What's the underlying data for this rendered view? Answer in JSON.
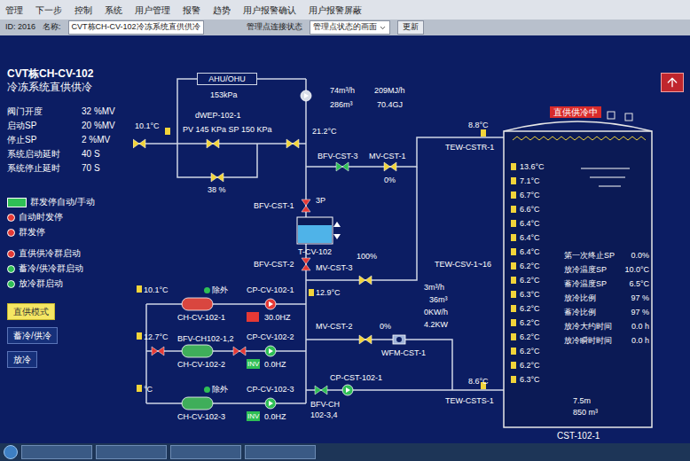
{
  "menu": [
    "管理",
    "下一步",
    "控制",
    "系统",
    "用户管理",
    "报警",
    "趋势",
    "用户报警确认",
    "用户报警屏蔽"
  ],
  "toolbar": {
    "id": "ID: 2016",
    "name_label": "名称:",
    "name": "CVT栋CH-CV-102冷冻系统直供供冷",
    "view_label": "管理点连接状态",
    "view": "管理点状态的画面",
    "button": "更新"
  },
  "panel": {
    "title": "CVT栋CH-CV-102",
    "subtitle": "冷冻系统直供供冷",
    "params": [
      {
        "label": "阀门开度",
        "value": "32 %MV"
      },
      {
        "label": "启动SP",
        "value": "20 %MV"
      },
      {
        "label": "停止SP",
        "value": "2 %MV"
      },
      {
        "label": "系统启动延时",
        "value": "40 S"
      },
      {
        "label": "系统停止延时",
        "value": "70 S"
      }
    ],
    "legend_groups": [
      [
        {
          "label": "群发停自动/手动",
          "kind": "box",
          "color": "#2fbf55"
        },
        {
          "label": "自动时发停",
          "kind": "dot",
          "color": "#e53935"
        },
        {
          "label": "群发停",
          "kind": "dot",
          "color": "#e53935"
        }
      ],
      [
        {
          "label": "直供供冷群启动",
          "kind": "dot",
          "color": "#e53935"
        },
        {
          "label": "蓄冷/供冷群启动",
          "kind": "dot",
          "color": "#2fbf55"
        },
        {
          "label": "放冷群启动",
          "kind": "dot",
          "color": "#2fbf55"
        }
      ]
    ],
    "modes": [
      {
        "label": "直供模式",
        "selected": true
      },
      {
        "label": "蓄冷/供冷",
        "selected": false
      },
      {
        "label": "放冷",
        "selected": false
      }
    ]
  },
  "diagram": {
    "ahu": "AHU/OHU",
    "texts": {
      "ahu_kpa": "153kPa",
      "top_temp": "10.1°C",
      "dwep": "dWEP-102-1",
      "pv_sp": "PV 145 KPa SP 150 KPa",
      "ret_temp": "21.2°C",
      "bypass_pct": "38 %",
      "flow_rate": "74m³/h",
      "heat_rate": "209MJ/h",
      "flow_total": "286m³",
      "heat_total": "70.4GJ",
      "bfv_cst3": "BFV-CST-3",
      "mv_cst1": "MV-CST-1",
      "mv_cst1_pct": "0%",
      "top_tank_temp": "8.8°C",
      "tew_cstr": "TEW-CSTR-1",
      "bfv_cst1": "BFV-CST-1",
      "cst1_3p": "3P",
      "tcv": "T-CV-102",
      "bfv_cst2": "BFV-CST-2",
      "mv_cst3": "MV-CST-3",
      "mv_cst3_pct": "100%",
      "ch_supply_temp": "12.9°C",
      "tew_csv": "TEW-CSV-1~16",
      "flow_now": "3m³/h",
      "vol_now": "36m³",
      "energy": "0KW/h",
      "power": "4.2KW",
      "mv_cst2": "MV-CST-2",
      "mv_cst2_pct": "0%",
      "wfm": "WFM-CST-1",
      "cp_cst": "CP-CST-102-1",
      "bfv_ch34": "BFV-CH 102-3,4",
      "bottom_tank_temp": "8.6°C",
      "tew_csts": "TEW-CSTS-1"
    },
    "valves": {
      "main_left": {
        "color": "#f2d43a"
      },
      "main_center": {
        "color": "#f2d43a"
      },
      "main_right": {
        "color": "#f2d43a"
      },
      "bypass": {
        "color": "#f2d43a"
      },
      "bfv_cst3": {
        "color": "#2fbf55"
      },
      "mv_cst1": {
        "color": "#f2d43a"
      },
      "bfv_cst1": {
        "color": "#e53935"
      },
      "bfv_cst2": {
        "color": "#e53935"
      },
      "mv_cst3": {
        "color": "#f2d43a"
      },
      "mv_cst2": {
        "color": "#f2d43a"
      },
      "bfv_ch12_a": {
        "color": "#e53935"
      },
      "bfv_ch12_b": {
        "color": "#e53935"
      },
      "bfv_ch34": {
        "color": "#2fbf55"
      }
    },
    "pumps": {
      "ahu_pump": {
        "color": "#d8dde8"
      },
      "cp_cst": {
        "color": "#2fbf55"
      }
    },
    "chillers": [
      {
        "name": "CH-CV-102-1",
        "running": true,
        "temp": "10.1°C",
        "tag": "除外",
        "valve_label": null,
        "pump": "CP-CV-102-1",
        "pump_running": true,
        "drive": "",
        "drive_color": "#e53935",
        "hz": "30.0HZ"
      },
      {
        "name": "CH-CV-102-2",
        "running": false,
        "temp": "12.7°C",
        "tag": null,
        "valve_label": "BFV-CH102-1,2",
        "pump": "CP-CV-102-2",
        "pump_running": false,
        "drive": "INV",
        "drive_color": "#2fbf55",
        "hz": "0.0HZ"
      },
      {
        "name": "CH-CV-102-3",
        "running": false,
        "temp": "°C",
        "tag": "除外",
        "valve_label": null,
        "pump": "CP-CV-102-3",
        "pump_running": false,
        "drive": "INV",
        "drive_color": "#2fbf55",
        "hz": "0.0HZ"
      }
    ]
  },
  "tank": {
    "name": "CST-102-1",
    "status": "直供供冷中",
    "temps": [
      "13.6°C",
      "7.1°C",
      "6.7°C",
      "6.6°C",
      "6.4°C",
      "6.4°C",
      "6.4°C",
      "6.2°C",
      "6.2°C",
      "6.3°C",
      "6.2°C",
      "6.2°C",
      "6.2°C",
      "6.2°C",
      "6.2°C",
      "6.3°C"
    ],
    "params": [
      {
        "label": "第一次终止SP",
        "value": "0.0%"
      },
      {
        "label": "放冷温度SP",
        "value": "10.0°C"
      },
      {
        "label": "蓄冷温度SP",
        "value": "6.5°C"
      },
      {
        "label": "放冷比例",
        "value": "97 %"
      },
      {
        "label": "蓄冷比例",
        "value": "97 %"
      },
      {
        "label": "放冷大约时间",
        "value": "0.0 h"
      },
      {
        "label": "放冷瞬时时间",
        "value": "0.0 h"
      }
    ],
    "height": "7.5m",
    "volume": "850 m³"
  }
}
